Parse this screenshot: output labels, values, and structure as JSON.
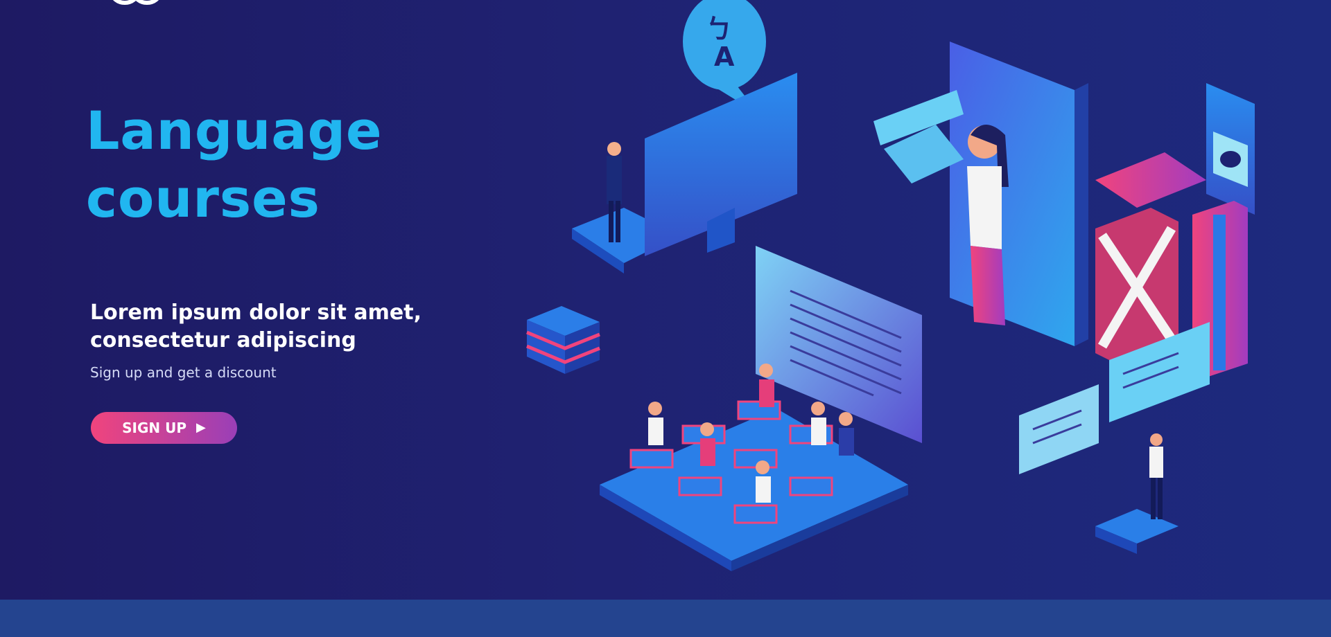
{
  "hero": {
    "title_line1": "Language",
    "title_line2": "courses",
    "subhead_line1": "Lorem ipsum dolor sit amet,",
    "subhead_line2": "consectetur adipiscing",
    "tagline": "Sign up and get a discount",
    "signup_label": "SIGN UP",
    "signup_icon": "play-icon"
  },
  "illustration": {
    "bubble_text1": "ㄅ",
    "bubble_text2": "A"
  },
  "colors": {
    "background": "#1f2272",
    "title": "#21b6f0",
    "button_start": "#f0447d",
    "button_end": "#9a3fb7",
    "footer_band": "#24448f"
  }
}
